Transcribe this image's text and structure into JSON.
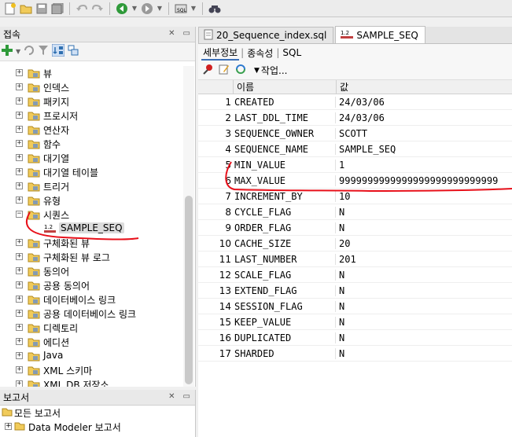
{
  "toolbar": {
    "buttons": [
      "new-icon",
      "open-icon",
      "save-icon",
      "save-all-icon",
      "undo-icon",
      "redo-icon",
      "back-icon",
      "forward-icon",
      "sql-icon",
      "find-icon"
    ]
  },
  "connections": {
    "title": "접속",
    "tree": [
      {
        "label": "뷰",
        "icon": "folder-icon"
      },
      {
        "label": "인덱스",
        "icon": "folder-icon"
      },
      {
        "label": "패키지",
        "icon": "folder-icon"
      },
      {
        "label": "프로시저",
        "icon": "folder-icon"
      },
      {
        "label": "연산자",
        "icon": "folder-icon"
      },
      {
        "label": "함수",
        "icon": "folder-icon"
      },
      {
        "label": "대기열",
        "icon": "folder-icon"
      },
      {
        "label": "대기열 테이블",
        "icon": "folder-icon"
      },
      {
        "label": "트리거",
        "icon": "folder-icon"
      },
      {
        "label": "유형",
        "icon": "folder-icon"
      },
      {
        "label": "시퀀스",
        "icon": "folder-icon",
        "expanded": true
      },
      {
        "label": "SAMPLE_SEQ",
        "icon": "sequence-icon",
        "child": true
      },
      {
        "label": "구체화된 뷰",
        "icon": "folder-icon"
      },
      {
        "label": "구체화된 뷰 로그",
        "icon": "folder-icon"
      },
      {
        "label": "동의어",
        "icon": "folder-icon"
      },
      {
        "label": "공용 동의어",
        "icon": "folder-icon"
      },
      {
        "label": "데이터베이스 링크",
        "icon": "folder-icon"
      },
      {
        "label": "공용 데이터베이스 링크",
        "icon": "folder-icon"
      },
      {
        "label": "디렉토리",
        "icon": "folder-icon"
      },
      {
        "label": "에디션",
        "icon": "folder-icon"
      },
      {
        "label": "Java",
        "icon": "folder-icon"
      },
      {
        "label": "XML 스키마",
        "icon": "folder-icon"
      },
      {
        "label": "XML DB 저장소",
        "icon": "folder-icon"
      }
    ]
  },
  "reports": {
    "title": "보고서",
    "items": [
      {
        "label": "모든 보고서"
      },
      {
        "label": "Data Modeler 보고서"
      }
    ]
  },
  "editor": {
    "tabs": [
      {
        "label": "20_Sequence_index.sql",
        "active": false
      },
      {
        "label": "SAMPLE_SEQ",
        "active": true
      }
    ],
    "subtabs": [
      "세부정보",
      "종속성",
      "SQL"
    ],
    "actions_label": "작업...",
    "columns": {
      "name": "이름",
      "value": "값"
    },
    "rows": [
      {
        "n": "1",
        "name": "CREATED",
        "value": "24/03/06"
      },
      {
        "n": "2",
        "name": "LAST_DDL_TIME",
        "value": "24/03/06"
      },
      {
        "n": "3",
        "name": "SEQUENCE_OWNER",
        "value": "SCOTT"
      },
      {
        "n": "4",
        "name": "SEQUENCE_NAME",
        "value": "SAMPLE_SEQ"
      },
      {
        "n": "5",
        "name": "MIN_VALUE",
        "value": "1"
      },
      {
        "n": "6",
        "name": "MAX_VALUE",
        "value": "9999999999999999999999999999"
      },
      {
        "n": "7",
        "name": "INCREMENT_BY",
        "value": "10"
      },
      {
        "n": "8",
        "name": "CYCLE_FLAG",
        "value": "N"
      },
      {
        "n": "9",
        "name": "ORDER_FLAG",
        "value": "N"
      },
      {
        "n": "10",
        "name": "CACHE_SIZE",
        "value": "20"
      },
      {
        "n": "11",
        "name": "LAST_NUMBER",
        "value": "201"
      },
      {
        "n": "12",
        "name": "SCALE_FLAG",
        "value": "N"
      },
      {
        "n": "13",
        "name": "EXTEND_FLAG",
        "value": "N"
      },
      {
        "n": "14",
        "name": "SESSION_FLAG",
        "value": "N"
      },
      {
        "n": "15",
        "name": "KEEP_VALUE",
        "value": "N"
      },
      {
        "n": "16",
        "name": "DUPLICATED",
        "value": "N"
      },
      {
        "n": "17",
        "name": "SHARDED",
        "value": "N"
      }
    ]
  },
  "colors": {
    "annotation": "#e8101a",
    "accent": "#3b6fb6"
  }
}
